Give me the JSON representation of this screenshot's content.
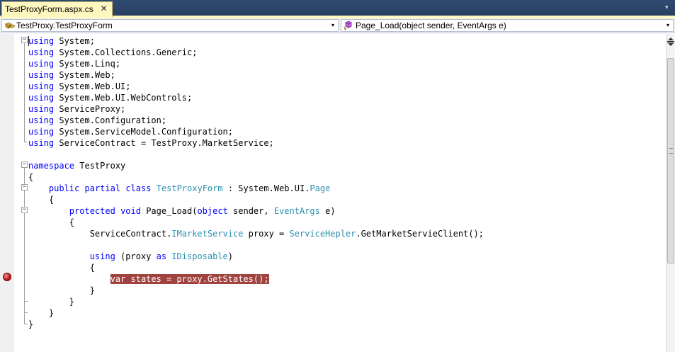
{
  "tab": {
    "title": "TestProxyForm.aspx.cs",
    "close": "✕"
  },
  "navbar": {
    "type_selector": "TestProxy.TestProxyForm",
    "member_selector": "Page_Load(object sender, EventArgs e)",
    "type_icon": "class-icon",
    "member_icon": "method-icon",
    "arrow": "▾"
  },
  "colors": {
    "keyword": "#0000ff",
    "type": "#2b91af",
    "breakpoint_highlight": "#a0433f",
    "tab_active": "#fff7c0",
    "tabstrip": "#2f4a72"
  },
  "code": {
    "lines": [
      [
        [
          "kw",
          "using"
        ],
        [
          "t",
          " System;"
        ]
      ],
      [
        [
          "kw",
          "using"
        ],
        [
          "t",
          " System.Collections.Generic;"
        ]
      ],
      [
        [
          "kw",
          "using"
        ],
        [
          "t",
          " System.Linq;"
        ]
      ],
      [
        [
          "kw",
          "using"
        ],
        [
          "t",
          " System.Web;"
        ]
      ],
      [
        [
          "kw",
          "using"
        ],
        [
          "t",
          " System.Web.UI;"
        ]
      ],
      [
        [
          "kw",
          "using"
        ],
        [
          "t",
          " System.Web.UI.WebControls;"
        ]
      ],
      [
        [
          "kw",
          "using"
        ],
        [
          "t",
          " ServiceProxy;"
        ]
      ],
      [
        [
          "kw",
          "using"
        ],
        [
          "t",
          " System.Configuration;"
        ]
      ],
      [
        [
          "kw",
          "using"
        ],
        [
          "t",
          " System.ServiceModel.Configuration;"
        ]
      ],
      [
        [
          "kw",
          "using"
        ],
        [
          "t",
          " ServiceContract = TestProxy.MarketService;"
        ]
      ],
      [],
      [
        [
          "kw",
          "namespace"
        ],
        [
          "t",
          " TestProxy"
        ]
      ],
      [
        [
          "t",
          "{"
        ]
      ],
      [
        [
          "t",
          "    "
        ],
        [
          "kw",
          "public"
        ],
        [
          "t",
          " "
        ],
        [
          "kw",
          "partial"
        ],
        [
          "t",
          " "
        ],
        [
          "kw",
          "class"
        ],
        [
          "t",
          " "
        ],
        [
          "tp",
          "TestProxyForm"
        ],
        [
          "t",
          " : System.Web.UI."
        ],
        [
          "tp",
          "Page"
        ]
      ],
      [
        [
          "t",
          "    {"
        ]
      ],
      [
        [
          "t",
          "        "
        ],
        [
          "kw",
          "protected"
        ],
        [
          "t",
          " "
        ],
        [
          "kw",
          "void"
        ],
        [
          "t",
          " Page_Load("
        ],
        [
          "kw",
          "object"
        ],
        [
          "t",
          " sender, "
        ],
        [
          "tp",
          "EventArgs"
        ],
        [
          "t",
          " e)"
        ]
      ],
      [
        [
          "t",
          "        {"
        ]
      ],
      [
        [
          "t",
          "            ServiceContract."
        ],
        [
          "tp",
          "IMarketService"
        ],
        [
          "t",
          " proxy = "
        ],
        [
          "tp",
          "ServiceHepler"
        ],
        [
          "t",
          ".GetMarketServieClient();"
        ]
      ],
      [],
      [
        [
          "t",
          "            "
        ],
        [
          "kw",
          "using"
        ],
        [
          "t",
          " (proxy "
        ],
        [
          "kw",
          "as"
        ],
        [
          "t",
          " "
        ],
        [
          "tp",
          "IDisposable"
        ],
        [
          "t",
          ")"
        ]
      ],
      [
        [
          "t",
          "            {"
        ]
      ],
      [
        [
          "t",
          "                "
        ],
        [
          "hl",
          "var states = proxy.GetStates();"
        ]
      ],
      [
        [
          "t",
          "            }"
        ]
      ],
      [
        [
          "t",
          "        }"
        ]
      ],
      [
        [
          "t",
          "    }"
        ]
      ],
      [
        [
          "t",
          "}"
        ]
      ]
    ]
  }
}
